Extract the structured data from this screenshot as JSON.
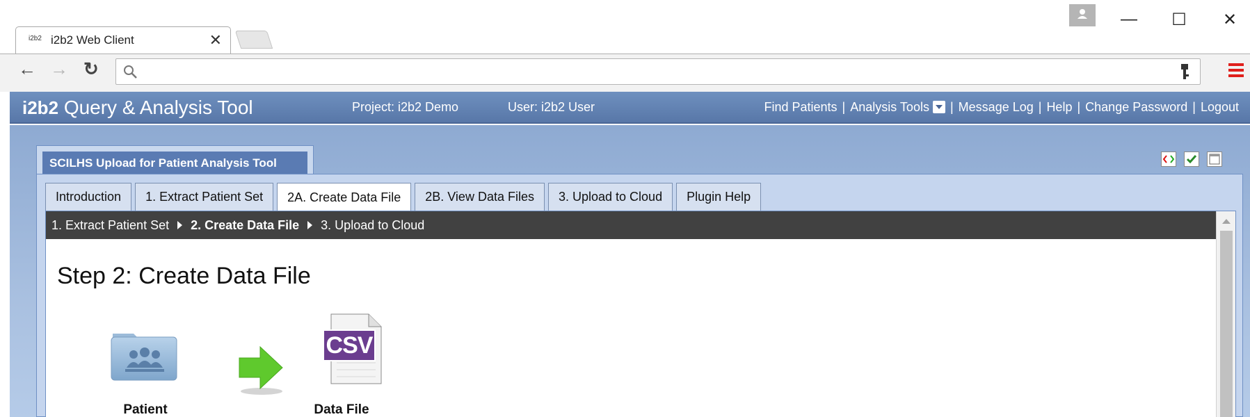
{
  "browser": {
    "tab_small_logo": "i2b2",
    "tab_title": "i2b2 Web Client",
    "tab_close": "✕",
    "window_controls": {
      "minimize": "—",
      "maximize": "☐",
      "close": "✕"
    },
    "address_value": ""
  },
  "header": {
    "logo_bold": "i2b2",
    "logo_rest": "Query & Analysis Tool",
    "project": "Project: i2b2 Demo",
    "user": "User: i2b2 User",
    "nav": {
      "find_patients": "Find Patients",
      "analysis_tools": "Analysis Tools",
      "message_log": "Message Log",
      "help": "Help",
      "change_password": "Change Password",
      "logout": "Logout",
      "separator": "|"
    }
  },
  "panel": {
    "title": "SCILHS Upload for Patient Analysis Tool",
    "tabs": [
      {
        "label": "Introduction",
        "active": false
      },
      {
        "label": "1. Extract Patient Set",
        "active": false
      },
      {
        "label": "2A. Create Data File",
        "active": true
      },
      {
        "label": "2B. View Data Files",
        "active": false
      },
      {
        "label": "3. Upload to Cloud",
        "active": false
      },
      {
        "label": "Plugin Help",
        "active": false
      }
    ],
    "steps": [
      "1. Extract Patient Set",
      "2. Create Data File",
      "3. Upload to Cloud"
    ],
    "current_step_index": 1
  },
  "content": {
    "heading": "Step 2: Create Data File",
    "source_label": "Patient Set",
    "target_label": "Data File",
    "csv_text": "CSV"
  },
  "colors": {
    "header_blue": "#5877a8",
    "panel_blue": "#c5d5ee",
    "step_bar": "#414141",
    "arrow_green": "#5fc92d",
    "csv_purple": "#6b3d8f"
  }
}
